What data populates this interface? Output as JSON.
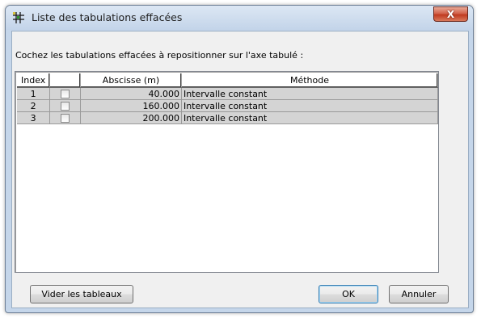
{
  "window": {
    "title": "Liste des tabulations effacées",
    "close_label": "X"
  },
  "instruction": "Cochez les tabulations effacées à repositionner sur l'axe tabulé :",
  "table": {
    "columns": [
      "Index",
      "",
      "Abscisse (m)",
      "Méthode"
    ],
    "rows": [
      {
        "index": "1",
        "checked": false,
        "abscisse": "40.000",
        "methode": "Intervalle constant"
      },
      {
        "index": "2",
        "checked": false,
        "abscisse": "160.000",
        "methode": "Intervalle constant"
      },
      {
        "index": "3",
        "checked": false,
        "abscisse": "200.000",
        "methode": "Intervalle constant"
      }
    ]
  },
  "buttons": {
    "clear": "Vider les tableaux",
    "ok": "OK",
    "cancel": "Annuler"
  }
}
